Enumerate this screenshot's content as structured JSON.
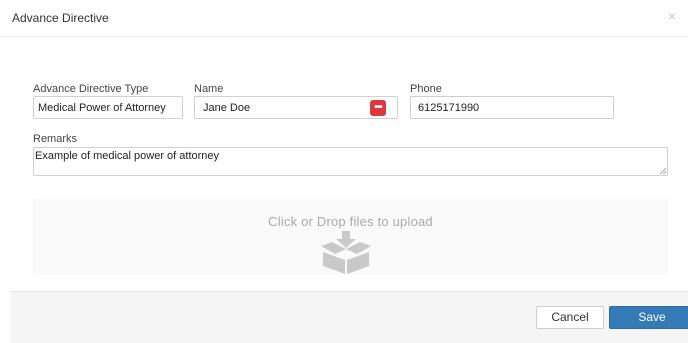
{
  "header": {
    "title": "Advance Directive",
    "close_icon": "close-icon"
  },
  "form": {
    "type_label": "Advance Directive Type",
    "type_value": "Medical Power of Attorney",
    "name_label": "Name",
    "name_value": "Jane Doe",
    "name_button_icon": "password-dots-icon",
    "phone_label": "Phone",
    "phone_value": "6125171990",
    "remarks_label": "Remarks",
    "remarks_value": "Example of medical power of attorney"
  },
  "upload": {
    "text": "Click or Drop files to upload",
    "icon": "box-download-icon"
  },
  "footer": {
    "cancel_label": "Cancel",
    "save_label": "Save"
  },
  "colors": {
    "primary": "#337ab7",
    "danger": "#d9393b"
  }
}
